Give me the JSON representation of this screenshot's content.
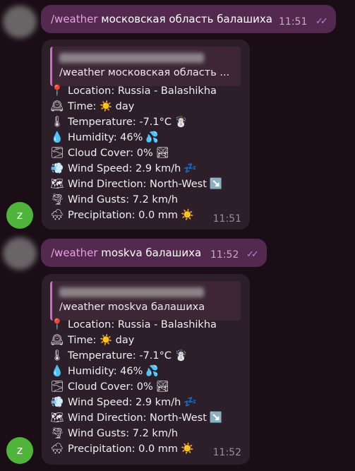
{
  "messages": [
    {
      "outgoing": {
        "command": "/weather",
        "text": " московская область балашиха",
        "time": "11:51",
        "status_icon": "double-check-icon"
      },
      "incoming": {
        "avatar_letter": "z",
        "reply_preview": "/weather московская область ...",
        "lines": [
          {
            "icon": "📍",
            "text": "Location: Russia - Balashikha",
            "trail": ""
          },
          {
            "icon": "🕰",
            "text": "Time: ☀️ day",
            "trail": ""
          },
          {
            "icon": "🌡",
            "text": "Temperature: -7.1°C",
            "trail": "☃️"
          },
          {
            "icon": "💧",
            "text": "Humidity: 46%",
            "trail": "💦"
          },
          {
            "icon": "🌫",
            "text": "Cloud Cover: 0%",
            "trail": "🏞"
          },
          {
            "icon": "💨",
            "text": "Wind Speed: 2.9 km/h",
            "trail": "💤"
          },
          {
            "icon": "🗺",
            "text": "Wind Direction: North-West",
            "trail": "↘️"
          },
          {
            "icon": "🌪",
            "text": "Wind Gusts: 7.2 km/h",
            "trail": ""
          },
          {
            "icon": "🌨",
            "text": "Precipitation: 0.0 mm",
            "trail": "☀️"
          }
        ],
        "time": "11:51"
      }
    },
    {
      "outgoing": {
        "command": "/weather",
        "text": " moskva балашиха",
        "time": "11:52",
        "status_icon": "double-check-icon"
      },
      "incoming": {
        "avatar_letter": "z",
        "reply_preview": "/weather moskva балашиха",
        "lines": [
          {
            "icon": "📍",
            "text": "Location: Russia - Balashikha",
            "trail": ""
          },
          {
            "icon": "🕰",
            "text": "Time: ☀️ day",
            "trail": ""
          },
          {
            "icon": "🌡",
            "text": "Temperature: -7.1°C",
            "trail": "☃️"
          },
          {
            "icon": "💧",
            "text": "Humidity: 46%",
            "trail": "💦"
          },
          {
            "icon": "🌫",
            "text": "Cloud Cover: 0%",
            "trail": "🏞"
          },
          {
            "icon": "💨",
            "text": "Wind Speed: 2.9 km/h",
            "trail": "💤"
          },
          {
            "icon": "🗺",
            "text": "Wind Direction: North-West",
            "trail": "↘️"
          },
          {
            "icon": "🌪",
            "text": "Wind Gusts: 7.2 km/h",
            "trail": ""
          },
          {
            "icon": "🌨",
            "text": "Precipitation: 0.0 mm",
            "trail": "☀️"
          }
        ],
        "time": "11:52"
      }
    }
  ],
  "colors": {
    "background": "#1a0d15",
    "outgoing_bubble": "#54294f",
    "incoming_bubble": "#2c1f29",
    "command_link": "#e8a0e4",
    "reply_accent": "#d06ac8",
    "avatar_green": "#4fb43a"
  }
}
